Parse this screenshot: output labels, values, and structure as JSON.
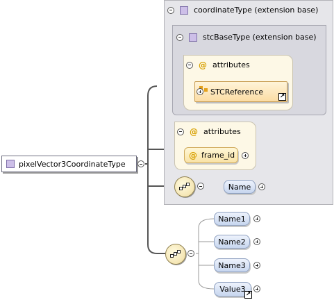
{
  "root": {
    "label": "pixelVector3CoordinateType"
  },
  "coordinate_ext": {
    "title": "coordinateType (extension base)",
    "stc_ext": {
      "title": "stcBaseType (extension base)",
      "attributes": {
        "title": "attributes",
        "group_ref": "STCReference"
      }
    },
    "attributes": {
      "title": "attributes",
      "items": [
        "frame_id"
      ]
    },
    "sequence": {
      "elements": [
        "Name"
      ]
    }
  },
  "own_sequence": {
    "elements": [
      "Name1",
      "Name2",
      "Name3",
      "Value3"
    ]
  },
  "icons": {
    "type": "complex-type-icon",
    "attribute": "at-sign-icon",
    "compositor": "sequence-icon",
    "expand": "plus-circle-icon",
    "collapse": "minus-circle-icon",
    "reference": "reference-arrow-icon"
  },
  "colors": {
    "extension_bg": "#e6e6ea",
    "attributes_bg": "#fdf8e6",
    "element_fill": "#c7d6ef",
    "attribute_fill": "#f9e3a6"
  }
}
